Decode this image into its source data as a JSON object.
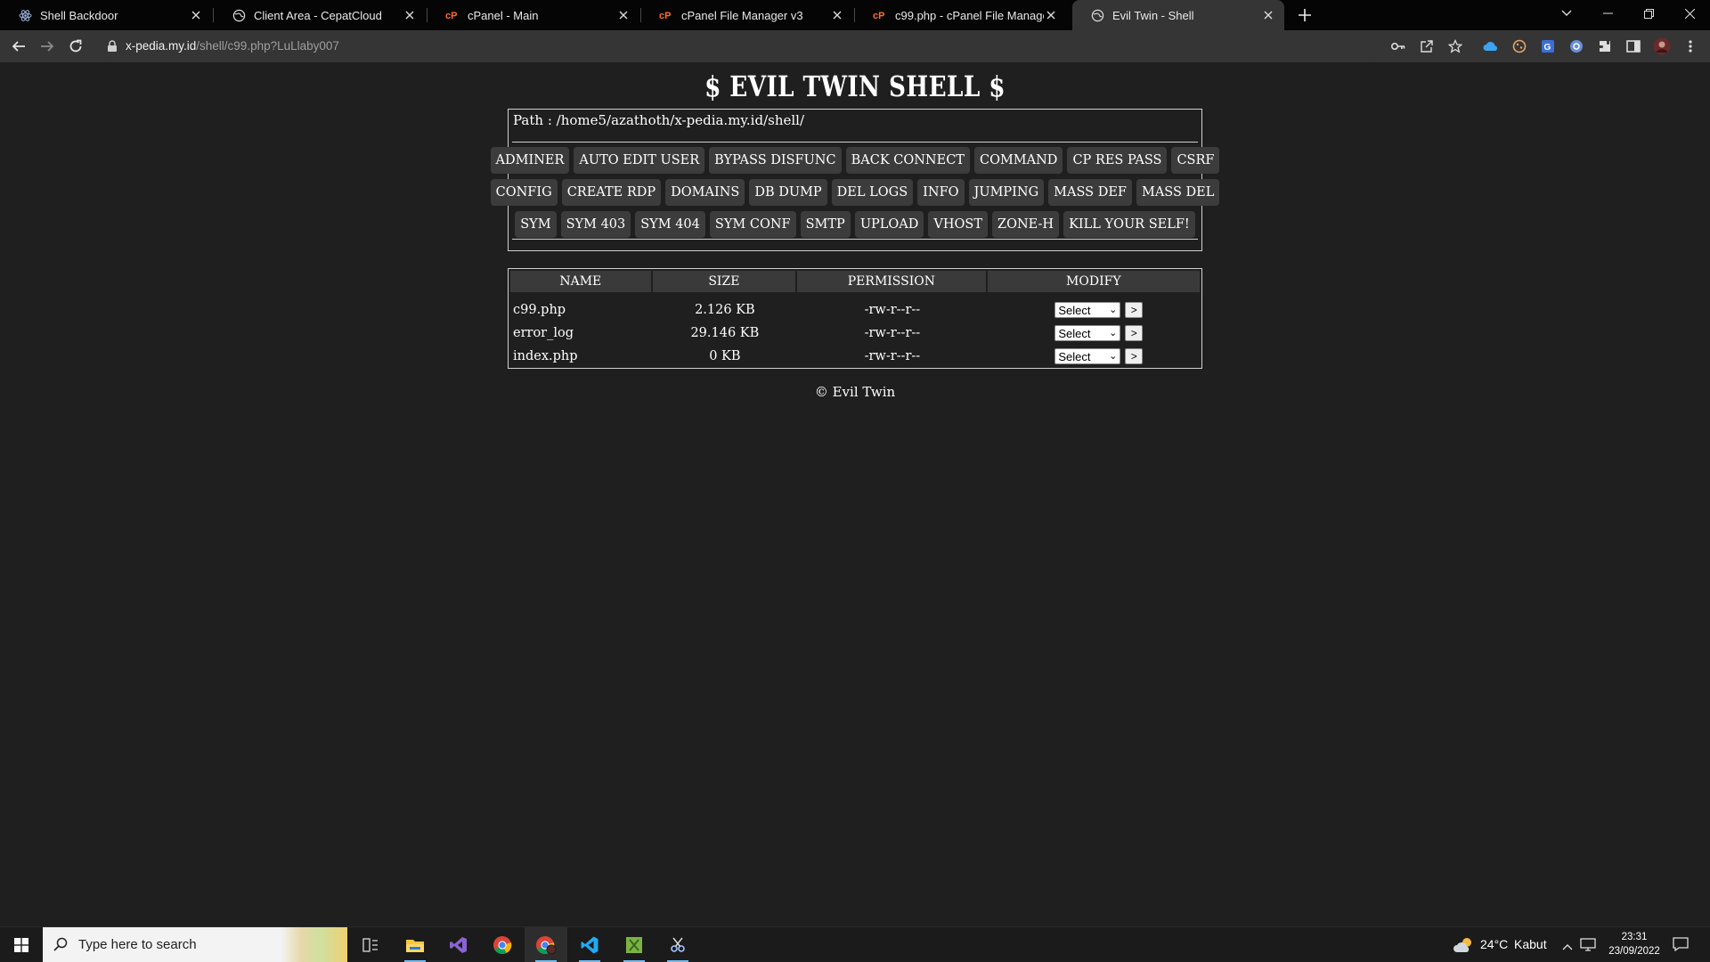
{
  "browser": {
    "tabs": [
      {
        "title": "Shell Backdoor",
        "icon": "react-icon"
      },
      {
        "title": "Client Area - CepatCloud",
        "icon": "globe-icon"
      },
      {
        "title": "cPanel - Main",
        "icon": "cpanel-icon"
      },
      {
        "title": "cPanel File Manager v3",
        "icon": "cpanel-icon"
      },
      {
        "title": "c99.php - cPanel File Manager v3",
        "icon": "cpanel-icon"
      },
      {
        "title": "Evil Twin - Shell",
        "icon": "globe-icon",
        "active": true
      }
    ],
    "url_host": "x-pedia.my.id",
    "url_path": "/shell/c99.php?LuLlaby007"
  },
  "page": {
    "title": "$ EVIL TWIN SHELL $",
    "path_label": "Path :",
    "path_value": "/home5/azathoth/x-pedia.my.id/shell/",
    "buttons": {
      "row1": [
        "ADMINER",
        "AUTO EDIT USER",
        "BYPASS DISFUNC",
        "BACK CONNECT",
        "COMMAND",
        "CP RES PASS",
        "CSRF"
      ],
      "row2": [
        "CONFIG",
        "CREATE RDP",
        "DOMAINS",
        "DB DUMP",
        "DEL LOGS",
        "INFO",
        "JUMPING",
        "MASS DEF",
        "MASS DEL"
      ],
      "row3": [
        "SYM",
        "SYM 403",
        "SYM 404",
        "SYM CONF",
        "SMTP",
        "UPLOAD",
        "VHOST",
        "ZONE-H",
        "KILL YOUR SELF!"
      ]
    },
    "table": {
      "headers": [
        "NAME",
        "SIZE",
        "PERMISSION",
        "MODIFY"
      ],
      "rows": [
        {
          "name": "c99.php",
          "size": "2.126 KB",
          "perm": "-rw-r--r--",
          "select": "Select",
          "go": ">"
        },
        {
          "name": "error_log",
          "size": "29.146 KB",
          "perm": "-rw-r--r--",
          "select": "Select",
          "go": ">"
        },
        {
          "name": "index.php",
          "size": "0 KB",
          "perm": "-rw-r--r--",
          "select": "Select",
          "go": ">"
        }
      ]
    },
    "footer": "© Evil Twin"
  },
  "taskbar": {
    "search_placeholder": "Type here to search",
    "temperature": "24°C",
    "weather": "Kabut",
    "time": "23:31",
    "date": "23/09/2022"
  },
  "colors": {
    "page_bg": "#1f1f1f",
    "button_bg": "#3c3c3c",
    "border": "#d0d0d0",
    "accent": "#76b9ed"
  }
}
